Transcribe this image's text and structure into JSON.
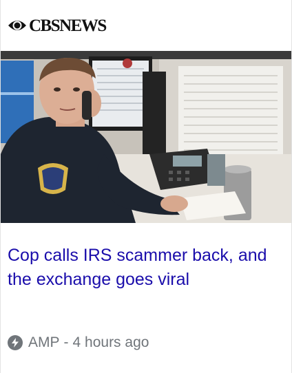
{
  "publisher": {
    "name": "CBSNEWS",
    "logo_icon": "cbs-eye-icon"
  },
  "article": {
    "headline": "Cop calls IRS scammer back, and the exchange goes viral",
    "image_icon": "article-photo"
  },
  "meta": {
    "format": "AMP",
    "separator": "-",
    "time_ago": "4 hours ago",
    "icon": "amp-lightning-icon"
  },
  "colors": {
    "headline": "#1a0dab",
    "meta": "#70757a",
    "logo": "#111111"
  }
}
